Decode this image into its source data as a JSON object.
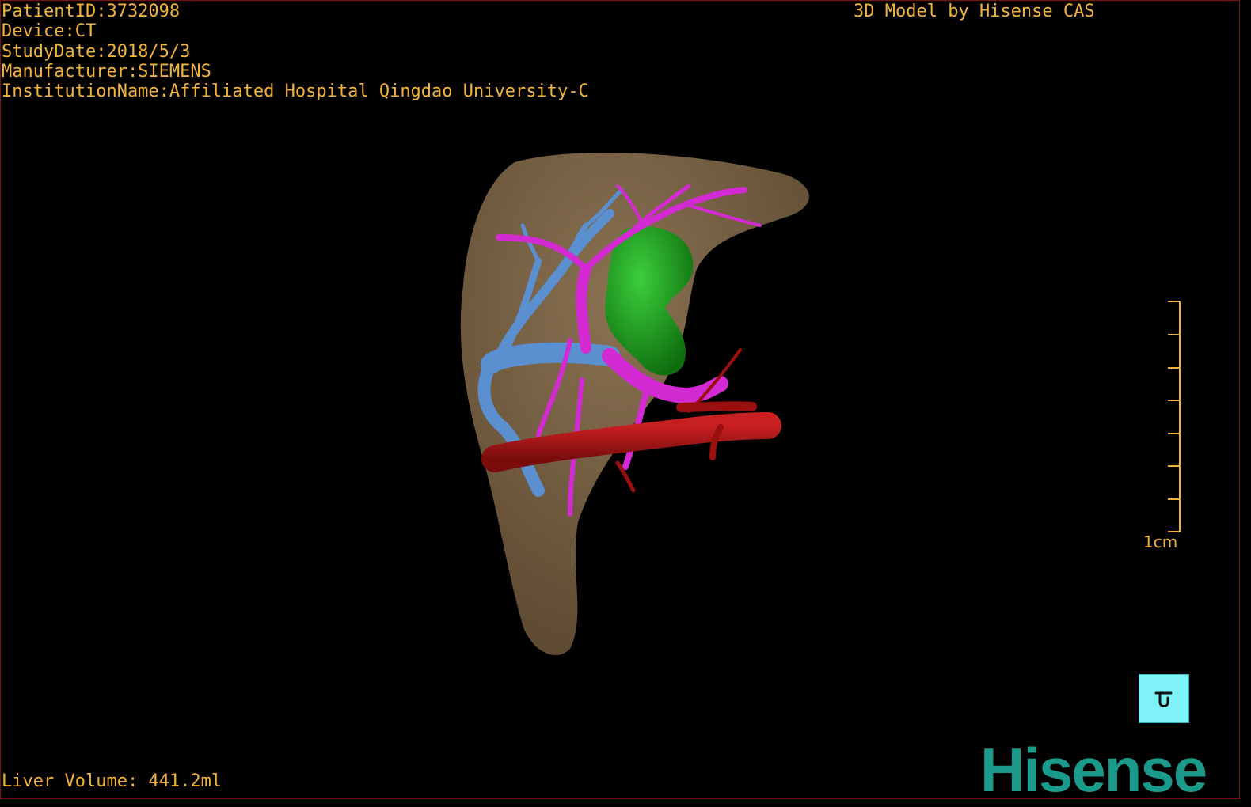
{
  "header": {
    "patient_id": "PatientID:3732098",
    "device": "Device:CT",
    "study_date": "StudyDate:2018/5/3",
    "manufacturer": "Manufacturer:SIEMENS",
    "institution": "InstitutionName:Affiliated Hospital Qingdao University-C"
  },
  "title": "3D Model by Hisense CAS",
  "footer": {
    "liver_volume": "Liver Volume: 441.2ml"
  },
  "scale_bar": {
    "label": "1cm"
  },
  "orientation_cube": {
    "icon": "orientation-cube-icon",
    "color": "#7ff2f7"
  },
  "brand": {
    "logo_text": "Hisense",
    "color": "#1a9a8a"
  },
  "colors": {
    "text": "#f2b33d",
    "liver": "#7a6346",
    "portal_vein": "#d42ad4",
    "hepatic_vein": "#5a8fd0",
    "vena_cava": "#a01414",
    "gallbladder": "#1a9a1a"
  }
}
